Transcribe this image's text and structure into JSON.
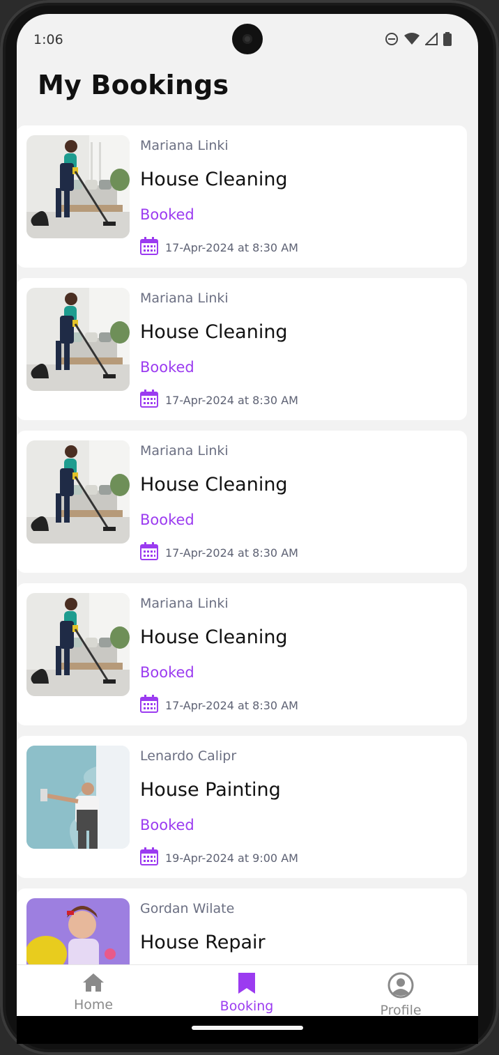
{
  "status_bar": {
    "time": "1:06",
    "icons": [
      "dnd-icon",
      "wifi-icon",
      "signal-icon",
      "battery-icon"
    ]
  },
  "page": {
    "title": "My Bookings"
  },
  "bookings": [
    {
      "provider": "Mariana Linki",
      "service": "House Cleaning",
      "status": "Booked",
      "datetime": "17-Apr-2024 at 8:30 AM",
      "image": "cleaning"
    },
    {
      "provider": "Mariana Linki",
      "service": "House Cleaning",
      "status": "Booked",
      "datetime": "17-Apr-2024 at 8:30 AM",
      "image": "cleaning"
    },
    {
      "provider": "Mariana Linki",
      "service": "House Cleaning",
      "status": "Booked",
      "datetime": "17-Apr-2024 at 8:30 AM",
      "image": "cleaning"
    },
    {
      "provider": "Mariana Linki",
      "service": "House Cleaning",
      "status": "Booked",
      "datetime": "17-Apr-2024 at 8:30 AM",
      "image": "cleaning"
    },
    {
      "provider": "Lenardo Calipr",
      "service": "House Painting",
      "status": "Booked",
      "datetime": "19-Apr-2024 at 9:00 AM",
      "image": "painting"
    },
    {
      "provider": "Gordan Wilate",
      "service": "House Repair",
      "status": "",
      "datetime": "",
      "image": "repair"
    }
  ],
  "nav": {
    "items": [
      {
        "label": "Home",
        "icon": "home-icon",
        "active": false
      },
      {
        "label": "Booking",
        "icon": "bookmark-icon",
        "active": true
      },
      {
        "label": "Profile",
        "icon": "profile-icon",
        "active": false
      }
    ]
  },
  "colors": {
    "accent": "#9b3bf0",
    "inactive": "#8a8a8a",
    "background": "#f2f2f2"
  }
}
